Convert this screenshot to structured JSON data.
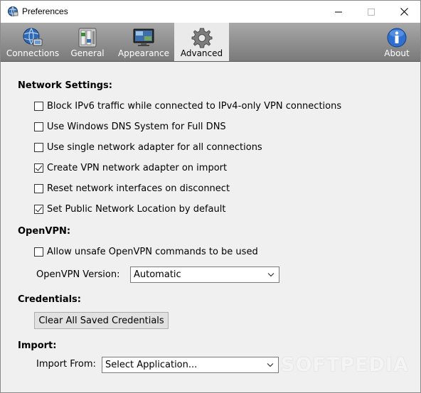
{
  "window": {
    "title": "Preferences"
  },
  "toolbar": {
    "items": [
      {
        "label": "Connections",
        "icon": "globe-network-icon"
      },
      {
        "label": "General",
        "icon": "switches-icon"
      },
      {
        "label": "Appearance",
        "icon": "monitor-icon"
      },
      {
        "label": "Advanced",
        "icon": "gear-icon",
        "active": true
      },
      {
        "label": "About",
        "icon": "info-icon"
      }
    ]
  },
  "network": {
    "title": "Network Settings:",
    "options": [
      {
        "label": "Block IPv6 traffic while connected to IPv4-only VPN connections",
        "checked": false
      },
      {
        "label": "Use Windows DNS System for Full DNS",
        "checked": false
      },
      {
        "label": "Use single network adapter for all connections",
        "checked": false
      },
      {
        "label": "Create VPN network adapter on import",
        "checked": true
      },
      {
        "label": "Reset network interfaces on disconnect",
        "checked": false
      },
      {
        "label": "Set Public Network Location by default",
        "checked": true
      }
    ]
  },
  "openvpn": {
    "title": "OpenVPN:",
    "unsafe_label": "Allow unsafe OpenVPN commands to be used",
    "unsafe_checked": false,
    "version_label": "OpenVPN Version:",
    "version_value": "Automatic"
  },
  "credentials": {
    "title": "Credentials:",
    "clear_button": "Clear All Saved Credentials"
  },
  "import": {
    "title": "Import:",
    "from_label": "Import From:",
    "from_value": "Select Application..."
  },
  "watermark": "SOFTPEDIA",
  "colors": {
    "toolbar_bg": "#8e8e8e",
    "active_tab_bg": "#eaeaea",
    "window_bg": "#f0f0f0"
  }
}
